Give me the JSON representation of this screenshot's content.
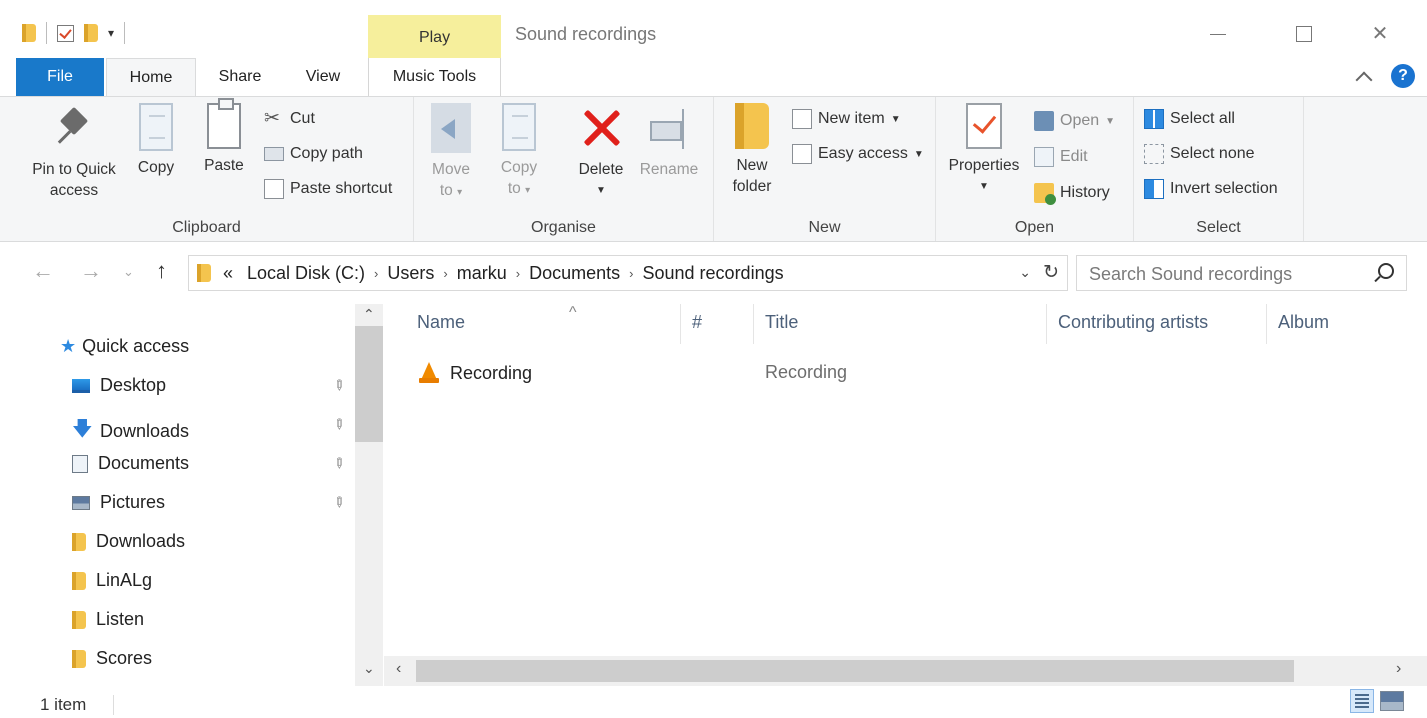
{
  "window": {
    "title": "Sound recordings",
    "context_tab": "Play"
  },
  "tabs": {
    "file": "File",
    "home": "Home",
    "share": "Share",
    "view": "View",
    "music_tools": "Music Tools"
  },
  "ribbon": {
    "clipboard": {
      "label": "Clipboard",
      "pin_to_quick_access": "Pin to Quick access",
      "copy": "Copy",
      "paste": "Paste",
      "cut": "Cut",
      "copy_path": "Copy path",
      "paste_shortcut": "Paste shortcut"
    },
    "organise": {
      "label": "Organise",
      "move_to_line1": "Move",
      "move_to_line2": "to",
      "copy_to_line1": "Copy",
      "copy_to_line2": "to",
      "delete": "Delete",
      "rename": "Rename"
    },
    "new": {
      "label": "New",
      "new_folder_line1": "New",
      "new_folder_line2": "folder",
      "new_item": "New item",
      "easy_access": "Easy access"
    },
    "open": {
      "label": "Open",
      "properties": "Properties",
      "open": "Open",
      "edit": "Edit",
      "history": "History"
    },
    "select": {
      "label": "Select",
      "select_all": "Select all",
      "select_none": "Select none",
      "invert_selection": "Invert selection"
    }
  },
  "address": {
    "overflow": "«",
    "crumbs": [
      "Local Disk (C:)",
      "Users",
      "marku",
      "Documents",
      "Sound recordings"
    ],
    "search_placeholder": "Search Sound recordings"
  },
  "nav": {
    "quick_access": "Quick access",
    "items": [
      {
        "label": "Desktop",
        "icon": "desktop-icon",
        "pinned": true
      },
      {
        "label": "Downloads",
        "icon": "download-icon",
        "pinned": true
      },
      {
        "label": "Documents",
        "icon": "documents-icon",
        "pinned": true
      },
      {
        "label": "Pictures",
        "icon": "pictures-icon",
        "pinned": true
      },
      {
        "label": "Downloads",
        "icon": "folder-icon",
        "pinned": false
      },
      {
        "label": "LinALg",
        "icon": "folder-icon",
        "pinned": false
      },
      {
        "label": "Listen",
        "icon": "folder-icon",
        "pinned": false
      },
      {
        "label": "Scores",
        "icon": "folder-icon",
        "pinned": false
      }
    ]
  },
  "columns": {
    "name": "Name",
    "number": "#",
    "title": "Title",
    "contributing_artists": "Contributing artists",
    "album": "Album"
  },
  "files": [
    {
      "name": "Recording",
      "title": "Recording",
      "icon": "vlc-media-icon"
    }
  ],
  "status": {
    "item_count": "1 item"
  },
  "colors": {
    "file_tab": "#1979ca",
    "context_tab": "#f6ef9c",
    "ribbon_bg": "#f5f6f7",
    "accent": "#2d8ae0",
    "delete_red": "#e0201b"
  }
}
